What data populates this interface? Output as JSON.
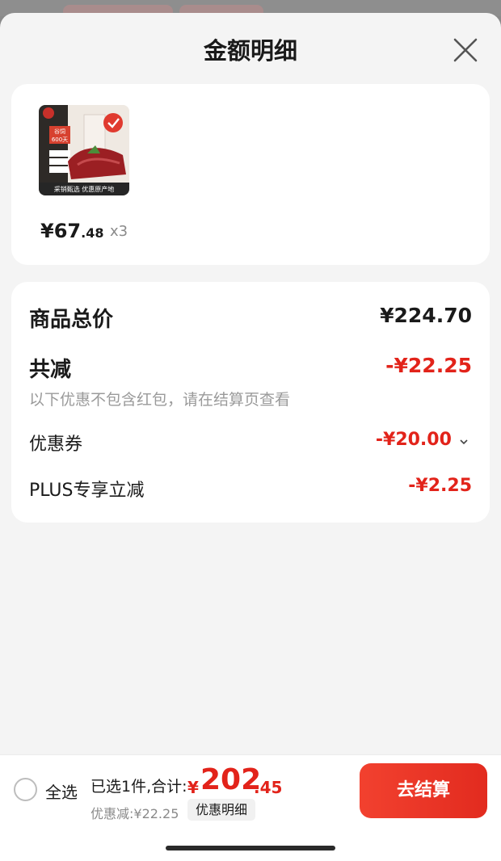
{
  "sheet": {
    "title": "金额明细"
  },
  "product": {
    "image_top_text": "谷饲",
    "image_badge": "600天",
    "image_caption": "采销甄选 优惠原产地",
    "price_int": "¥67",
    "price_dec": ".48",
    "quantity": "x3"
  },
  "summary": {
    "total_label": "商品总价",
    "total_value": "¥224.70",
    "reduce_label": "共减",
    "reduce_value": "-¥22.25",
    "note": "以下优惠不包含红包，请在结算页查看",
    "coupon_label": "优惠券",
    "coupon_value": "-¥20.00",
    "plus_label": "PLUS专享立减",
    "plus_value": "-¥2.25"
  },
  "bottom": {
    "select_all": "全选",
    "selected_text": "已选1件,合计:",
    "total_symbol": "¥",
    "total_int": "202",
    "total_dec": ".45",
    "discount_text": "优惠减:¥22.25",
    "detail_button": "优惠明细",
    "checkout_button": "去结算"
  },
  "colors": {
    "accent": "#e2231a",
    "background": "#f4f4f4",
    "card": "#ffffff"
  }
}
